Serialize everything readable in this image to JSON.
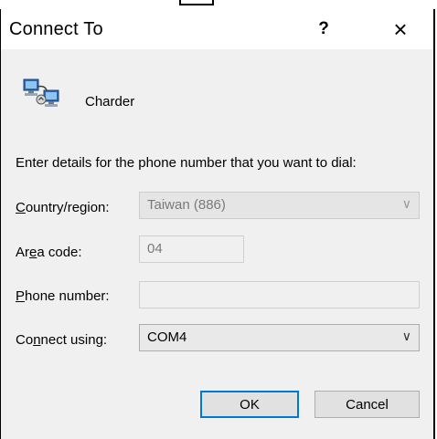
{
  "window": {
    "title": "Connect To",
    "help_glyph": "?",
    "close_glyph": "×"
  },
  "entry": {
    "name": "Charder",
    "icon": "phone-connection-icon"
  },
  "instructions": "Enter details for the phone number that you want to dial:",
  "form": {
    "country": {
      "label_pre": "",
      "label_key": "C",
      "label_post": "ountry/region:",
      "value": "Taiwan (886)"
    },
    "area": {
      "label_pre": "Ar",
      "label_key": "e",
      "label_post": "a code:",
      "value": "04"
    },
    "phone": {
      "label_pre": "",
      "label_key": "P",
      "label_post": "hone number:",
      "value": ""
    },
    "connect": {
      "label_pre": "Co",
      "label_key": "n",
      "label_post": "nect using:",
      "value": "COM4"
    }
  },
  "buttons": {
    "ok": "OK",
    "cancel": "Cancel"
  },
  "colors": {
    "default_button_border": "#0078d7",
    "dialog_background": "#f0f0f0"
  }
}
